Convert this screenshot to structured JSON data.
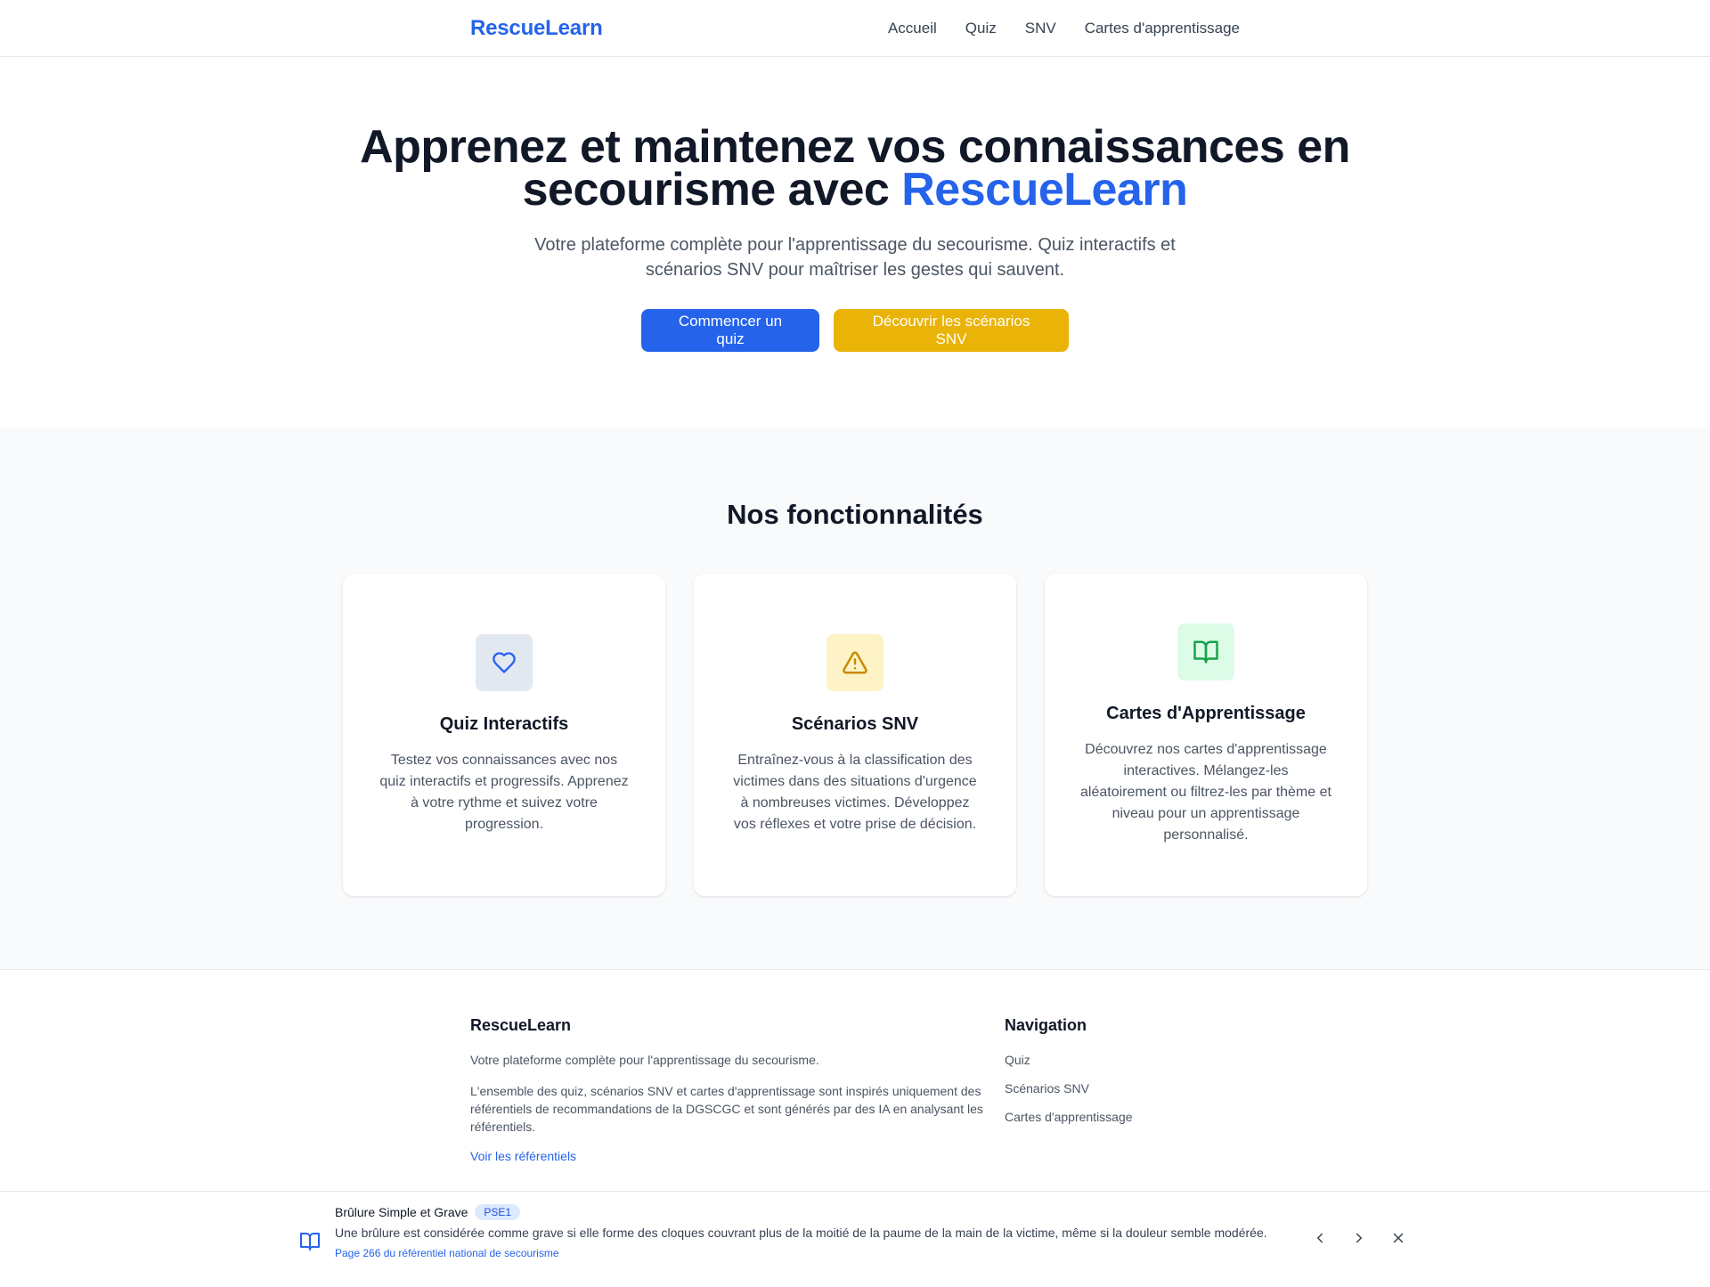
{
  "header": {
    "brand": "RescueLearn",
    "nav": [
      "Accueil",
      "Quiz",
      "SNV",
      "Cartes d'apprentissage"
    ]
  },
  "hero": {
    "title_part1": "Apprenez et maintenez vos connaissances en secourisme avec ",
    "title_accent": "RescueLearn",
    "subtitle": "Votre plateforme complète pour l'apprentissage du secourisme. Quiz interactifs et scénarios SNV pour maîtriser les gestes qui sauvent.",
    "cta_primary": "Commencer un quiz",
    "cta_secondary": "Découvrir les scénarios SNV"
  },
  "features": {
    "heading": "Nos fonctionnalités",
    "cards": [
      {
        "icon": "heart-icon",
        "title": "Quiz Interactifs",
        "text": "Testez vos connaissances avec nos quiz interactifs et progressifs. Apprenez à votre rythme et suivez votre progression."
      },
      {
        "icon": "warning-icon",
        "title": "Scénarios SNV",
        "text": "Entraînez-vous à la classification des victimes dans des situations d'urgence à nombreuses victimes. Développez vos réflexes et votre prise de décision."
      },
      {
        "icon": "book-open-icon",
        "title": "Cartes d'Apprentissage",
        "text": "Découvrez nos cartes d'apprentissage interactives. Mélangez-les aléatoirement ou filtrez-les par thème et niveau pour un apprentissage personnalisé."
      }
    ]
  },
  "footer": {
    "brand": "RescueLearn",
    "tagline": "Votre plateforme complète pour l'apprentissage du secourisme.",
    "disclaimer": "L'ensemble des quiz, scénarios SNV et cartes d'apprentissage sont inspirés uniquement des référentiels de recommandations de la DGSCGC et sont générés par des IA en analysant les référentiels.",
    "ref_link": "Voir les référentiels",
    "nav_heading": "Navigation",
    "nav_links": [
      "Quiz",
      "Scénarios SNV",
      "Cartes d'apprentissage"
    ]
  },
  "toast": {
    "title": "Brûlure Simple et Grave",
    "badge": "PSE1",
    "text": "Une brûlure est considérée comme grave si elle forme des cloques couvrant plus de la moitié de la paume de la main de la victime, même si la douleur semble modérée.",
    "reference": "Page 266 du référentiel national de secourisme"
  },
  "colors": {
    "primary": "#2563eb",
    "secondary": "#eab308",
    "success": "#16a34a"
  }
}
